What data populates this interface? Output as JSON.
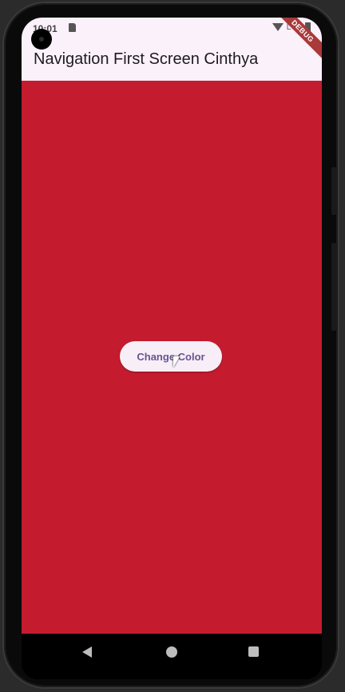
{
  "status_bar": {
    "time": "10:01",
    "network": "LTE"
  },
  "debug_banner": "DEBUG",
  "app_bar": {
    "title": "Navigation First Screen Cinthya"
  },
  "main": {
    "background_color": "#c41c2e",
    "button_label": "Change Color"
  },
  "nav_bar": {
    "icons": [
      "back-icon",
      "home-icon",
      "recents-icon"
    ]
  }
}
